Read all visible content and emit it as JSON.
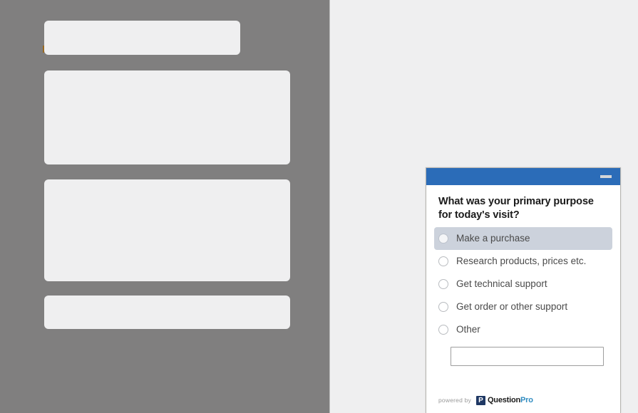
{
  "backdrop": {
    "overlay_color": "#807f7f",
    "skeleton_color": "#efeff0",
    "skeleton_blocks": [
      {
        "name": "skeleton-block-header"
      },
      {
        "name": "skeleton-block-hero"
      },
      {
        "name": "skeleton-block-body"
      },
      {
        "name": "skeleton-block-footer"
      }
    ]
  },
  "content_panel": {
    "background_color": "#efeff0"
  },
  "survey": {
    "titlebar": {
      "background_color": "#2b6cb8",
      "minimize_label": "—"
    },
    "question": "What was your primary purpose for today's visit?",
    "highlight_color": "#ccd2dc",
    "options": [
      {
        "label": "Make a purchase",
        "highlighted": true
      },
      {
        "label": "Research products, prices etc.",
        "highlighted": false
      },
      {
        "label": "Get technical support",
        "highlighted": false
      },
      {
        "label": "Get order or other support",
        "highlighted": false
      },
      {
        "label": "Other",
        "highlighted": false
      }
    ],
    "other_input": {
      "value": "",
      "placeholder": ""
    },
    "footer": {
      "powered_by": "powered by",
      "brand_mark": "P",
      "brand_name_part1": "Question",
      "brand_name_part2": "Pro",
      "brand_accent_color": "#2e8bc0"
    }
  }
}
